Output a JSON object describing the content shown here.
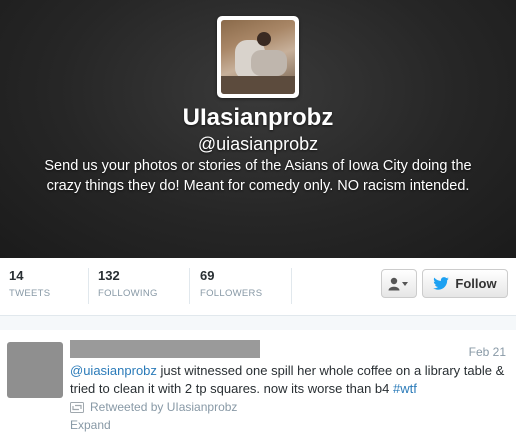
{
  "profile": {
    "display_name": "UIasianprobz",
    "handle": "@uiasianprobz",
    "bio": "Send us your photos or stories of the Asians of Iowa City doing the crazy things they do! Meant for comedy only. NO racism intended."
  },
  "stats": [
    {
      "value": "14",
      "label": "TWEETS"
    },
    {
      "value": "132",
      "label": "FOLLOWING"
    },
    {
      "value": "69",
      "label": "FOLLOWERS"
    }
  ],
  "actions": {
    "follow_label": "Follow"
  },
  "tweet": {
    "date": "Feb 21",
    "mention": "@uiasianprobz",
    "text_part1": " just witnessed one spill her whole coffee on a library table & tried to clean it with 2 tp squares. now its worse than b4 ",
    "hashtag": "#wtf",
    "retweeted_by": "Retweeted by UIasianprobz",
    "expand": "Expand"
  },
  "colors": {
    "link": "#2b7bb9",
    "twitter_blue": "#1da1f2",
    "muted": "#8899a6"
  },
  "icons": {
    "user_dropdown": "user-icon",
    "follow": "twitter-bird-icon",
    "retweet": "retweet-icon"
  }
}
